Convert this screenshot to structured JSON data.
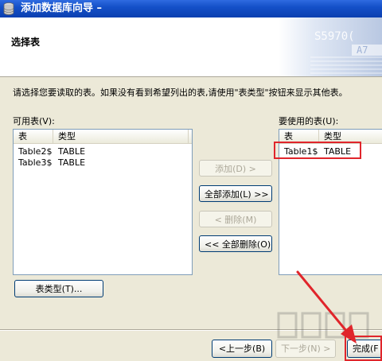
{
  "window": {
    "title": "添加数据库向导 –"
  },
  "header": {
    "title": "选择表",
    "deco_text_1": "S5970(",
    "deco_text_2": "A7"
  },
  "instruction": "请选择您要读取的表。如果没有看到希望列出的表,请使用\"表类型\"按钮来显示其他表。",
  "available": {
    "label": "可用表(V):",
    "columns": [
      "表",
      "类型"
    ],
    "rows": [
      {
        "name": "Table2$",
        "type": "TABLE"
      },
      {
        "name": "Table3$",
        "type": "TABLE"
      }
    ]
  },
  "selected": {
    "label": "要使用的表(U):",
    "columns": [
      "表",
      "类型"
    ],
    "rows": [
      {
        "name": "Table1$",
        "type": "TABLE"
      }
    ]
  },
  "buttons": {
    "add": "添加(D) >",
    "add_all": "全部添加(L) >>",
    "remove": "< 删除(M)",
    "remove_all": "<< 全部删除(O)",
    "table_types": "表类型(T)...",
    "back": "<上一步(B)",
    "next": "下一步(N) >",
    "finish": "完成(F"
  },
  "colors": {
    "titlebar": "#0b3fb0",
    "highlight": "#e0252b",
    "window_bg": "#ece9d8"
  }
}
